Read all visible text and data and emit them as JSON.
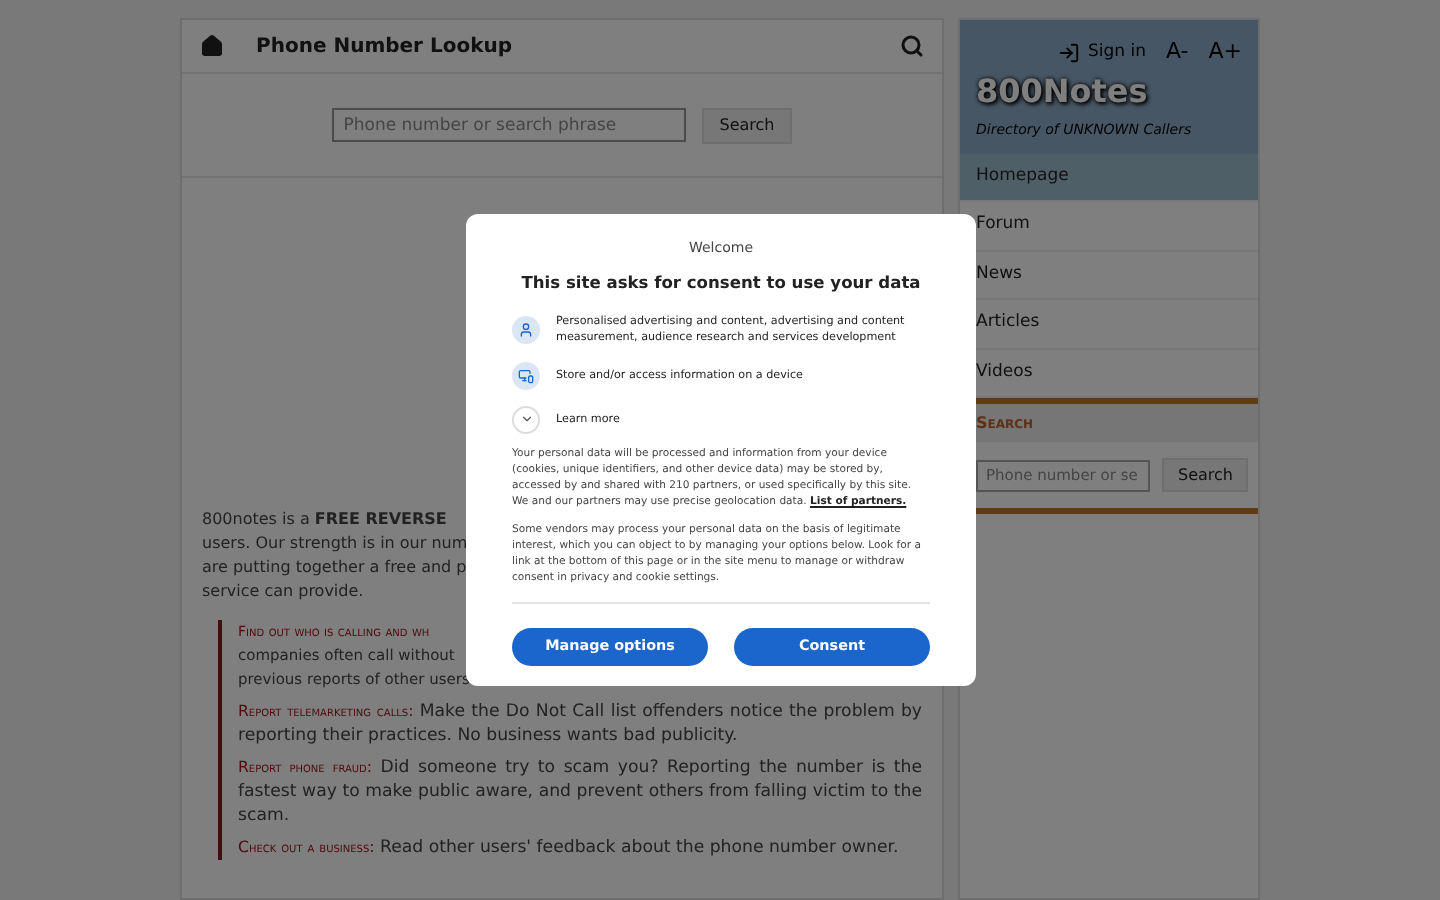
{
  "header": {
    "title": "Phone Number Lookup"
  },
  "search": {
    "placeholder": "Phone number or search phrase",
    "button": "Search"
  },
  "intro_lines": [
    "800notes is a **FREE REVERSE**",
    "users. Our strength is in our num",
    "are putting together a free and p",
    "service can provide."
  ],
  "features": [
    {
      "lead": "Find out who is calling and wh",
      "lines": [
        "companies often call without",
        "previous reports of other users"
      ]
    },
    {
      "lead": "Report telemarketing calls:",
      "lines": [
        "Make the Do Not Call list offenders notice the problem by reporting their practices. No business wants bad publicity."
      ]
    },
    {
      "lead": "Report phone fraud:",
      "lines": [
        "Did someone try to scam you? Reporting the number is the fastest way to make public aware, and prevent others from falling victim to the scam."
      ]
    },
    {
      "lead": "Check out a business:",
      "lines": [
        "Read other users' feedback about the phone number owner."
      ]
    }
  ],
  "sidebar": {
    "sign_in": "Sign in",
    "font_smaller": "A-",
    "font_larger": "A+",
    "logo": "800Notes",
    "tagline": "Directory of UNKNOWN Callers",
    "nav": [
      {
        "label": "Homepage",
        "selected": true
      },
      {
        "label": "Forum",
        "selected": false
      },
      {
        "label": "News",
        "selected": false
      },
      {
        "label": "Articles",
        "selected": false
      },
      {
        "label": "Videos",
        "selected": false
      }
    ],
    "search_title": "Search",
    "search_placeholder": "Phone number or se",
    "search_button": "Search"
  },
  "consent": {
    "welcome": "Welcome",
    "title": "This site asks for consent to use your data",
    "purposes": [
      {
        "kind": "person",
        "text": "Personalised advertising and content, advertising and content measurement, audience research and services development"
      },
      {
        "kind": "device",
        "text": "Store and/or access information on a device"
      }
    ],
    "learn_more": "Learn more",
    "paragraph_1": "Your personal data will be processed and information from your device (cookies, unique identifiers, and other device data) may be stored by, accessed by and shared with 210 partners, or used specifically by this site. We and our partners may use precise geolocation data.",
    "partners_link": "List of partners.",
    "paragraph_2": "Some vendors may process your personal data on the basis of legitimate interest, which you can object to by managing your options below. Look for a link at the bottom of this page or in the site menu to manage or withdraw consent in privacy and cookie settings.",
    "buttons": [
      "Manage options",
      "Consent"
    ]
  }
}
